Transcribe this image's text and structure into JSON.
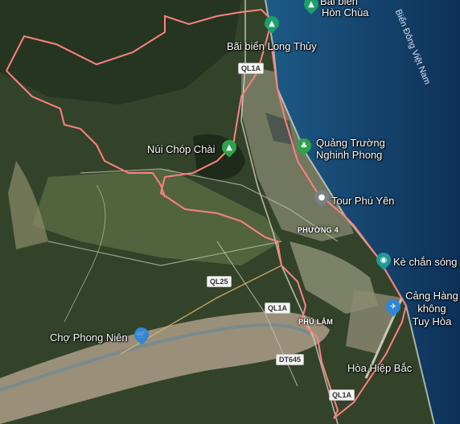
{
  "colors": {
    "land_dark": "#2f3f26",
    "land_light": "#6f7a52",
    "sea": "#123a63",
    "boundary": "#ff7a7a",
    "park_pin": "#2fa24b",
    "shop_pin": "#2f86d8",
    "gray_pin": "#7b8088",
    "teal_pin": "#1f9a9a",
    "beach_pin": "#1ba06a"
  },
  "pois": [
    {
      "name": "Bãi biển Hòn Chùa",
      "icon": "beach-icon"
    },
    {
      "name": "Bãi biển Long Thủy",
      "icon": "beach-icon"
    },
    {
      "name": "Núi Chóp Chài",
      "icon": "mountain-icon"
    },
    {
      "name": "Quảng Trường Nghinh Phong",
      "icon": "park-icon"
    },
    {
      "name": "Tour Phú Yên",
      "icon": "pin-icon"
    },
    {
      "name": "Kè chắn sóng",
      "icon": "camera-icon"
    },
    {
      "name": "Cảng Hàng không Tuy Hòa",
      "icon": "airport-icon"
    },
    {
      "name": "Chợ Phong Niên",
      "icon": "shopping-icon"
    },
    {
      "name": "Hòa Hiệp Bắc",
      "icon": ""
    }
  ],
  "poi_lines": {
    "hon_chua_1": "Bãi biển",
    "hon_chua_2": "Hòn Chùa",
    "long_thuy": "Bãi biển Long Thủy",
    "chop_chai": "Núi Chóp Chài",
    "quang_truong_1": "Quảng Trường",
    "quang_truong_2": "Nghinh Phong",
    "tour": "Tour Phú Yên",
    "ke_chan_song": "Kè chắn sóng",
    "cang_1": "Cảng Hàng",
    "cang_2": "không",
    "cang_3": "Tuy Hòa",
    "cho": "Chợ Phong Niên",
    "hoa_hiep": "Hòa Hiệp Bắc"
  },
  "areas": {
    "phuong4": "PHƯỜNG 4",
    "phu_lam": "PHÚ LÂM"
  },
  "roads": {
    "ql1a_1": "QL1A",
    "ql1a_2": "QL1A",
    "ql1a_3": "QL1A",
    "ql25": "QL25",
    "dt645": "DT645"
  },
  "sea_label": "Biển Đông Việt Nam"
}
